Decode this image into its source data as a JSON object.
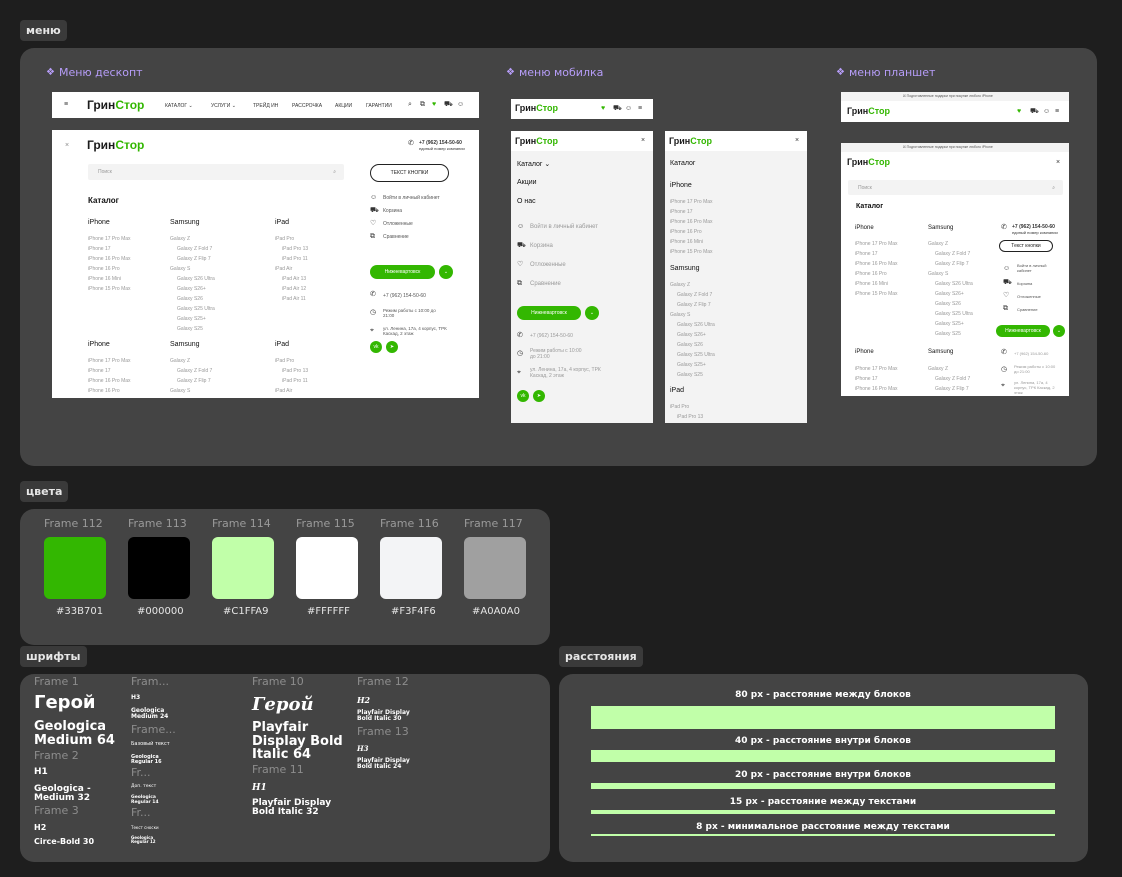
{
  "sections": {
    "menu": "меню",
    "colors": "цвета",
    "fonts": "шрифты",
    "spacing": "расстояния"
  },
  "frames": {
    "desktop": "Меню дескопт",
    "mobile": "меню мобилка",
    "tablet": "меню планшет"
  },
  "logo": {
    "part1": "Грин",
    "part2": "Стор"
  },
  "nav": {
    "catalog": "КАТАЛОГ",
    "services": "УСЛУГИ",
    "trade_in": "ТРЕЙД ИН",
    "installment": "РАССРОЧКА",
    "promos": "АКЦИИ",
    "guarantee": "ГАРАНТИИ"
  },
  "menu": {
    "phone": "+7 (962) 154-50-60",
    "phone_sub": "единый номер компании",
    "search_placeholder": "Поиск",
    "text_button": "ТЕКСТ КНОПКИ",
    "text_button_tablet": "Текст кнопки",
    "catalog_title": "Каталог",
    "catalog_mobile": "Каталог",
    "about": "Акции",
    "about_us": "О нас",
    "login": "Войти в личный кабинет",
    "cart": "Корзина",
    "favorites": "Отложенные",
    "compare": "Сравнение",
    "city": "Нижневартовск",
    "hours": "Режим работы с 10:00 до 21:00",
    "address": "ул. Ленина, 17а, 4 корпус, ТРК Каскад, 2 этаж",
    "promo_bar": "Подготовленные подарки при покупке любого iPhone"
  },
  "catalog": {
    "iphone_title": "iPhone",
    "iphone_items": [
      "iPhone 17 Pro Max",
      "iPhone 17",
      "iPhone 16 Pro Max",
      "iPhone 16 Pro",
      "iPhone 16 Mini",
      "iPhone 15 Pro Max"
    ],
    "samsung_title": "Samsung",
    "samsung_items": [
      "Galaxy Z",
      "Galaxy Z Fold 7",
      "Galaxy Z Flip 7",
      "Galaxy S",
      "Galaxy S26 Ultra",
      "Galaxy S26+",
      "Galaxy S26",
      "Galaxy S25 Ultra",
      "Galaxy S25+",
      "Galaxy S25"
    ],
    "ipad_title": "iPad",
    "ipad_items": [
      "iPad Pro",
      "iPad Pro 13",
      "iPad Pro 11",
      "iPad Air",
      "iPad Air 13",
      "iPad Air 12",
      "iPad Air 11"
    ]
  },
  "colors": [
    {
      "name": "Frame 112",
      "hex": "#33B701"
    },
    {
      "name": "Frame 113",
      "hex": "#000000"
    },
    {
      "name": "Frame 114",
      "hex": "#C1FFA9"
    },
    {
      "name": "Frame 115",
      "hex": "#FFFFFF"
    },
    {
      "name": "Frame 116",
      "hex": "#F3F4F6"
    },
    {
      "name": "Frame 117",
      "hex": "#A0A0A0"
    }
  ],
  "fonts": {
    "f1": "Frame 1",
    "f2": "Frame 2",
    "f3": "Frame 3",
    "fr": "Fram...",
    "fr2": "Frame...",
    "fr3": "Fr...",
    "fr4": "Fr...",
    "f10": "Frame 10",
    "f11": "Frame 11",
    "f12": "Frame 12",
    "f13": "Frame 13",
    "hero": "Герой",
    "hero_desc": "Geologica Medium 64",
    "h1": "H1",
    "h1_desc": "Geologica - Medium 32",
    "h2": "H2",
    "h2_desc": "Circe-Bold 30",
    "h3": "H3",
    "h3_desc": "Geologica Medium 24",
    "base": "Базовый текст",
    "base_desc": "Geologica Regular 16",
    "extra": "Доп. текст",
    "extra_desc": "Geologica Regular 14",
    "small": "Текст сноски",
    "small_desc": "Geologica Regular 12",
    "hero_serif": "Герой",
    "hero_serif_desc": "Playfair Display Bold Italic 64",
    "h1s": "H1",
    "h1s_desc": "Playfair Display Bold Italic 32",
    "h2s": "H2",
    "h2s_desc": "Playfair Display Bold Italic 30",
    "h3s": "H3",
    "h3s_desc": "Playfair Display Bold Italic 24"
  },
  "spacing": [
    {
      "label": "80 px - расстояние между блоков",
      "size": 80
    },
    {
      "label": "40 px - расстояние внутри блоков",
      "size": 40
    },
    {
      "label": "20 px - расстояние внутри блоков",
      "size": 20
    },
    {
      "label": "15 px - расстояние между текстами",
      "size": 15
    },
    {
      "label": "8 px - минимальное расстояние между текстами",
      "size": 8
    }
  ]
}
